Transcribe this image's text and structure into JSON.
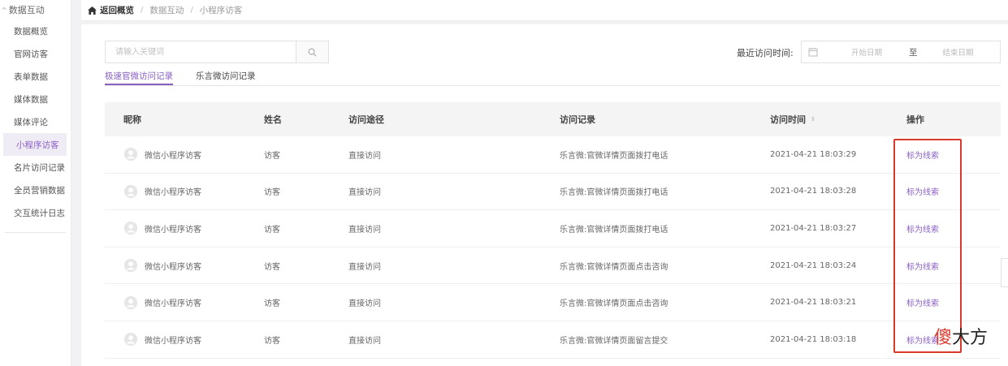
{
  "sidebar": {
    "group_label": "数据互动",
    "items": [
      {
        "label": "数据概览"
      },
      {
        "label": "官网访客"
      },
      {
        "label": "表单数据"
      },
      {
        "label": "媒体数据"
      },
      {
        "label": "媒体评论"
      },
      {
        "label": "小程序访客"
      },
      {
        "label": "名片访问记录"
      },
      {
        "label": "全员营销数据"
      },
      {
        "label": "交互统计日志"
      }
    ],
    "active_index": 5
  },
  "breadcrumb": {
    "home": "返回概览",
    "sep": "/",
    "items": [
      "数据互动",
      "小程序访客"
    ]
  },
  "search": {
    "placeholder": "请输入关键词",
    "value": ""
  },
  "date_filter": {
    "label": "最近访问时间:",
    "start_placeholder": "开始日期",
    "to": "至",
    "end_placeholder": "结束日期"
  },
  "tabs": [
    {
      "label": "极速官微访问记录",
      "active": true
    },
    {
      "label": "乐言微访问记录",
      "active": false
    }
  ],
  "table": {
    "headers": [
      "昵称",
      "姓名",
      "访问途径",
      "访问记录",
      "访问时间",
      "操作"
    ],
    "rows": [
      {
        "nickname": "微信小程序访客",
        "name": "访客",
        "channel": "直接访问",
        "record": "乐言微:官微详情页面拨打电话",
        "time": "2021-04-21 18:03:29",
        "action": "标为线索"
      },
      {
        "nickname": "微信小程序访客",
        "name": "访客",
        "channel": "直接访问",
        "record": "乐言微:官微详情页面拨打电话",
        "time": "2021-04-21 18:03:28",
        "action": "标为线索"
      },
      {
        "nickname": "微信小程序访客",
        "name": "访客",
        "channel": "直接访问",
        "record": "乐言微:官微详情页面拨打电话",
        "time": "2021-04-21 18:03:27",
        "action": "标为线索"
      },
      {
        "nickname": "微信小程序访客",
        "name": "访客",
        "channel": "直接访问",
        "record": "乐言微:官微详情页面点击咨询",
        "time": "2021-04-21 18:03:24",
        "action": "标为线索"
      },
      {
        "nickname": "微信小程序访客",
        "name": "访客",
        "channel": "直接访问",
        "record": "乐言微:官微详情页面点击咨询",
        "time": "2021-04-21 18:03:21",
        "action": "标为线索"
      },
      {
        "nickname": "微信小程序访客",
        "name": "访客",
        "channel": "直接访问",
        "record": "乐言微:官微详情页面留言提交",
        "time": "2021-04-21 18:03:18",
        "action": "标为线索"
      }
    ]
  },
  "watermark": {
    "first": "傻",
    "rest": "大方"
  },
  "colors": {
    "accent": "#8a5fc4",
    "annotation": "#d93a2e"
  }
}
